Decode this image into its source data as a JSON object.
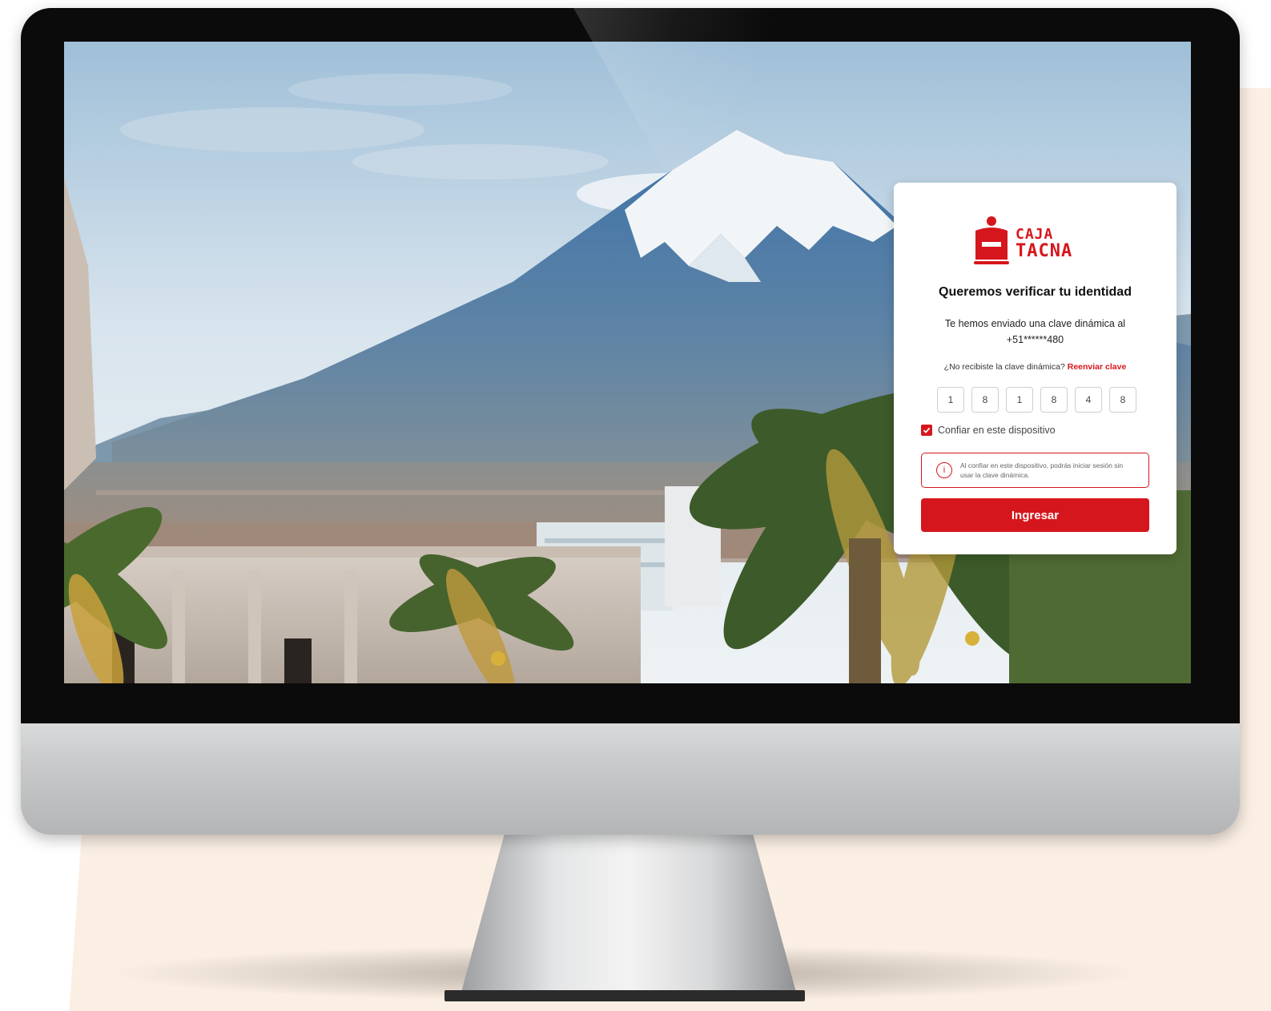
{
  "brand": {
    "name_line1": "CAJA",
    "name_line2": "TACNA",
    "color": "#d6161d"
  },
  "verify": {
    "title": "Queremos verificar tu identidad",
    "message_line1": "Te hemos enviado una clave dinámica al",
    "message_line2": "+51******480",
    "resend_prompt": "¿No recibiste la clave dinámica?",
    "resend_link": "Reenviar clave",
    "otp_digits": [
      "1",
      "8",
      "1",
      "8",
      "4",
      "8"
    ],
    "trust_label": "Confiar en este dispositivo",
    "trust_checked": true,
    "info_text": "Al confiar en este dispositivo, podrás iniciar sesión sin usar la clave dinámica.",
    "info_icon": "info-icon",
    "submit_label": "Ingresar"
  }
}
